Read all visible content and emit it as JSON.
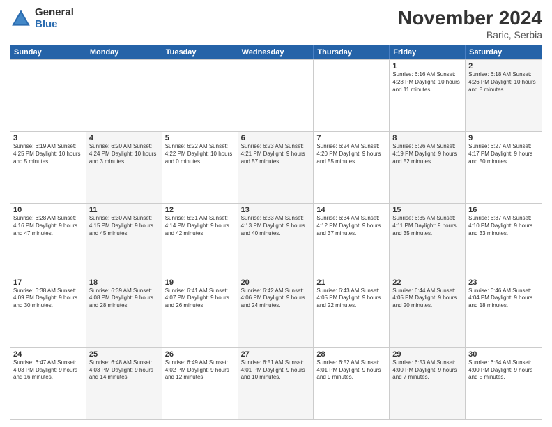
{
  "header": {
    "logo_general": "General",
    "logo_blue": "Blue",
    "month_title": "November 2024",
    "location": "Baric, Serbia"
  },
  "calendar": {
    "days_of_week": [
      "Sunday",
      "Monday",
      "Tuesday",
      "Wednesday",
      "Thursday",
      "Friday",
      "Saturday"
    ],
    "rows": [
      [
        {
          "day": "",
          "info": "",
          "shaded": false
        },
        {
          "day": "",
          "info": "",
          "shaded": false
        },
        {
          "day": "",
          "info": "",
          "shaded": false
        },
        {
          "day": "",
          "info": "",
          "shaded": false
        },
        {
          "day": "",
          "info": "",
          "shaded": false
        },
        {
          "day": "1",
          "info": "Sunrise: 6:16 AM\nSunset: 4:28 PM\nDaylight: 10 hours and 11 minutes.",
          "shaded": false
        },
        {
          "day": "2",
          "info": "Sunrise: 6:18 AM\nSunset: 4:26 PM\nDaylight: 10 hours and 8 minutes.",
          "shaded": true
        }
      ],
      [
        {
          "day": "3",
          "info": "Sunrise: 6:19 AM\nSunset: 4:25 PM\nDaylight: 10 hours and 5 minutes.",
          "shaded": false
        },
        {
          "day": "4",
          "info": "Sunrise: 6:20 AM\nSunset: 4:24 PM\nDaylight: 10 hours and 3 minutes.",
          "shaded": true
        },
        {
          "day": "5",
          "info": "Sunrise: 6:22 AM\nSunset: 4:22 PM\nDaylight: 10 hours and 0 minutes.",
          "shaded": false
        },
        {
          "day": "6",
          "info": "Sunrise: 6:23 AM\nSunset: 4:21 PM\nDaylight: 9 hours and 57 minutes.",
          "shaded": true
        },
        {
          "day": "7",
          "info": "Sunrise: 6:24 AM\nSunset: 4:20 PM\nDaylight: 9 hours and 55 minutes.",
          "shaded": false
        },
        {
          "day": "8",
          "info": "Sunrise: 6:26 AM\nSunset: 4:19 PM\nDaylight: 9 hours and 52 minutes.",
          "shaded": true
        },
        {
          "day": "9",
          "info": "Sunrise: 6:27 AM\nSunset: 4:17 PM\nDaylight: 9 hours and 50 minutes.",
          "shaded": false
        }
      ],
      [
        {
          "day": "10",
          "info": "Sunrise: 6:28 AM\nSunset: 4:16 PM\nDaylight: 9 hours and 47 minutes.",
          "shaded": false
        },
        {
          "day": "11",
          "info": "Sunrise: 6:30 AM\nSunset: 4:15 PM\nDaylight: 9 hours and 45 minutes.",
          "shaded": true
        },
        {
          "day": "12",
          "info": "Sunrise: 6:31 AM\nSunset: 4:14 PM\nDaylight: 9 hours and 42 minutes.",
          "shaded": false
        },
        {
          "day": "13",
          "info": "Sunrise: 6:33 AM\nSunset: 4:13 PM\nDaylight: 9 hours and 40 minutes.",
          "shaded": true
        },
        {
          "day": "14",
          "info": "Sunrise: 6:34 AM\nSunset: 4:12 PM\nDaylight: 9 hours and 37 minutes.",
          "shaded": false
        },
        {
          "day": "15",
          "info": "Sunrise: 6:35 AM\nSunset: 4:11 PM\nDaylight: 9 hours and 35 minutes.",
          "shaded": true
        },
        {
          "day": "16",
          "info": "Sunrise: 6:37 AM\nSunset: 4:10 PM\nDaylight: 9 hours and 33 minutes.",
          "shaded": false
        }
      ],
      [
        {
          "day": "17",
          "info": "Sunrise: 6:38 AM\nSunset: 4:09 PM\nDaylight: 9 hours and 30 minutes.",
          "shaded": false
        },
        {
          "day": "18",
          "info": "Sunrise: 6:39 AM\nSunset: 4:08 PM\nDaylight: 9 hours and 28 minutes.",
          "shaded": true
        },
        {
          "day": "19",
          "info": "Sunrise: 6:41 AM\nSunset: 4:07 PM\nDaylight: 9 hours and 26 minutes.",
          "shaded": false
        },
        {
          "day": "20",
          "info": "Sunrise: 6:42 AM\nSunset: 4:06 PM\nDaylight: 9 hours and 24 minutes.",
          "shaded": true
        },
        {
          "day": "21",
          "info": "Sunrise: 6:43 AM\nSunset: 4:05 PM\nDaylight: 9 hours and 22 minutes.",
          "shaded": false
        },
        {
          "day": "22",
          "info": "Sunrise: 6:44 AM\nSunset: 4:05 PM\nDaylight: 9 hours and 20 minutes.",
          "shaded": true
        },
        {
          "day": "23",
          "info": "Sunrise: 6:46 AM\nSunset: 4:04 PM\nDaylight: 9 hours and 18 minutes.",
          "shaded": false
        }
      ],
      [
        {
          "day": "24",
          "info": "Sunrise: 6:47 AM\nSunset: 4:03 PM\nDaylight: 9 hours and 16 minutes.",
          "shaded": false
        },
        {
          "day": "25",
          "info": "Sunrise: 6:48 AM\nSunset: 4:03 PM\nDaylight: 9 hours and 14 minutes.",
          "shaded": true
        },
        {
          "day": "26",
          "info": "Sunrise: 6:49 AM\nSunset: 4:02 PM\nDaylight: 9 hours and 12 minutes.",
          "shaded": false
        },
        {
          "day": "27",
          "info": "Sunrise: 6:51 AM\nSunset: 4:01 PM\nDaylight: 9 hours and 10 minutes.",
          "shaded": true
        },
        {
          "day": "28",
          "info": "Sunrise: 6:52 AM\nSunset: 4:01 PM\nDaylight: 9 hours and 9 minutes.",
          "shaded": false
        },
        {
          "day": "29",
          "info": "Sunrise: 6:53 AM\nSunset: 4:00 PM\nDaylight: 9 hours and 7 minutes.",
          "shaded": true
        },
        {
          "day": "30",
          "info": "Sunrise: 6:54 AM\nSunset: 4:00 PM\nDaylight: 9 hours and 5 minutes.",
          "shaded": false
        }
      ]
    ]
  }
}
